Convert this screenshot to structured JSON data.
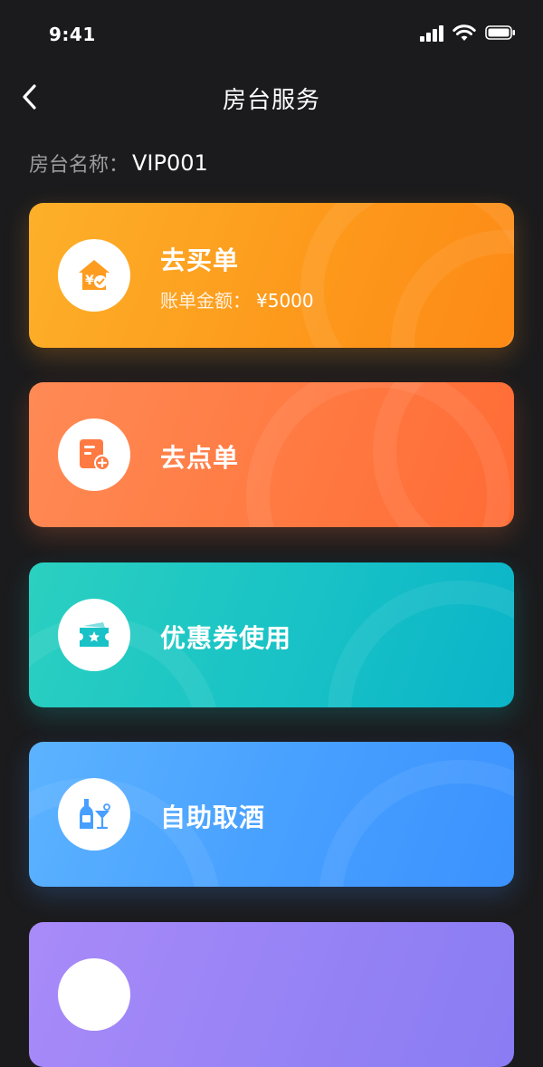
{
  "status_bar": {
    "time": "9:41"
  },
  "nav": {
    "title": "房台服务"
  },
  "room": {
    "label": "房台名称：",
    "value": "VIP001"
  },
  "cards": [
    {
      "title": "去买单",
      "subtitle_label": "账单金额：",
      "subtitle_value": "¥5000",
      "icon": "bill-house-icon",
      "color": "#fd9a1c"
    },
    {
      "title": "去点单",
      "icon": "order-add-icon",
      "color": "#ff7a42"
    },
    {
      "title": "优惠券使用",
      "icon": "coupon-icon",
      "color": "#18c2c6"
    },
    {
      "title": "自助取酒",
      "icon": "wine-icon",
      "color": "#479fff"
    },
    {
      "title": "",
      "icon": "",
      "color": "#9683f5"
    }
  ]
}
